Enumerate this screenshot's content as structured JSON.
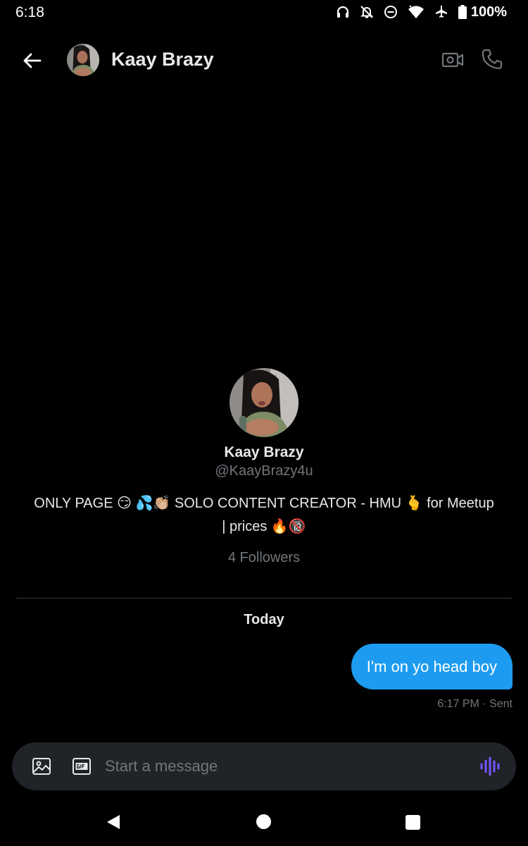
{
  "status_bar": {
    "time": "6:18",
    "battery": "100%",
    "icons": [
      "headphones-icon",
      "bell-off-icon",
      "do-not-disturb-icon",
      "wifi-icon",
      "airplane-icon",
      "battery-icon"
    ]
  },
  "header": {
    "name": "Kaay Brazy",
    "icons": [
      "back-arrow-icon",
      "video-call-icon",
      "phone-icon"
    ]
  },
  "profile": {
    "name": "Kaay Brazy",
    "handle": "@KaayBrazy4u",
    "bio_line1": "ONLY PAGE 😏 💦👏🏼 SOLO CONTENT CREATOR - HMU 🫰 for Meetup",
    "bio_line2": "| prices 🔥🔞",
    "followers": "4 Followers"
  },
  "conversation": {
    "day_label": "Today",
    "messages": [
      {
        "text": "I'm on yo head boy",
        "meta": "6:17 PM · Sent"
      }
    ]
  },
  "composer": {
    "placeholder": "Start a message",
    "icons": [
      "image-icon",
      "gif-icon",
      "voice-message-icon"
    ]
  },
  "colors": {
    "accent": "#1d9bf0",
    "background": "#000000",
    "muted_text": "#71767b",
    "voice_icon": "#7856ff"
  }
}
